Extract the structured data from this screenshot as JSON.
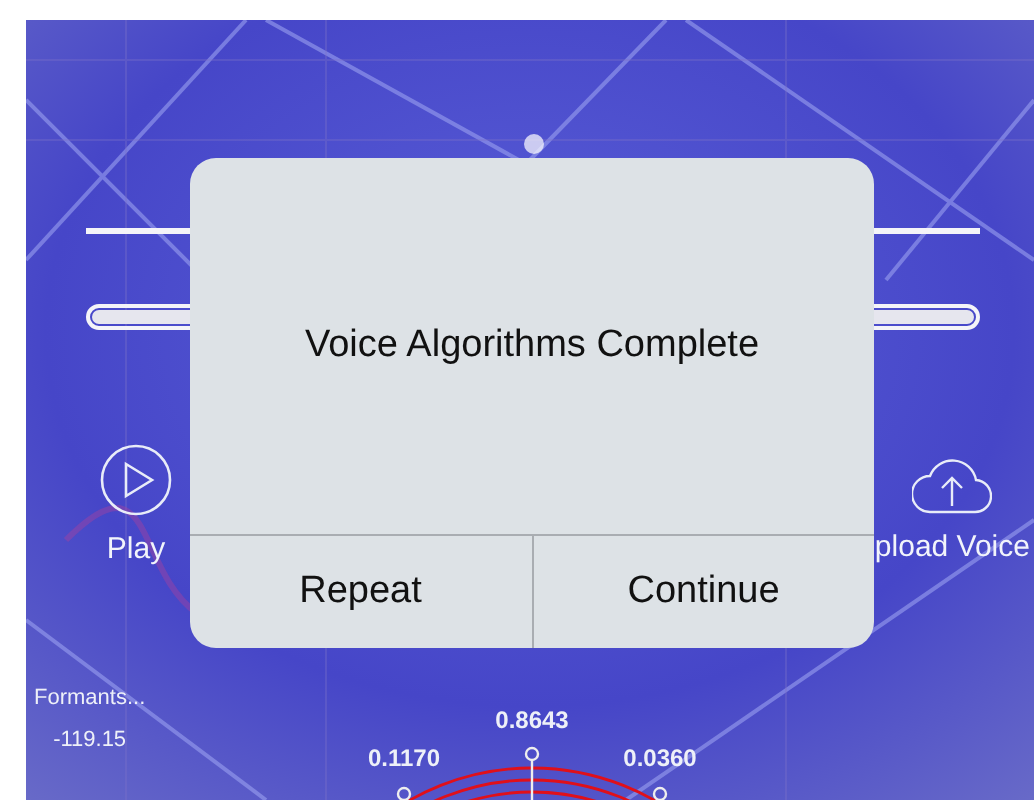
{
  "progress": {
    "level": 1
  },
  "controls": [
    {
      "kind": "play",
      "label": "Play"
    },
    {
      "kind": "upload",
      "label": "pload Voice"
    }
  ],
  "formants": {
    "label": "Formants...",
    "value": "-119.15"
  },
  "dial": {
    "readings": [
      "0.1170",
      "0.8643",
      "0.0360"
    ]
  },
  "alert": {
    "message": "Voice Algorithms Complete",
    "buttons": [
      "Repeat",
      "Continue"
    ]
  }
}
